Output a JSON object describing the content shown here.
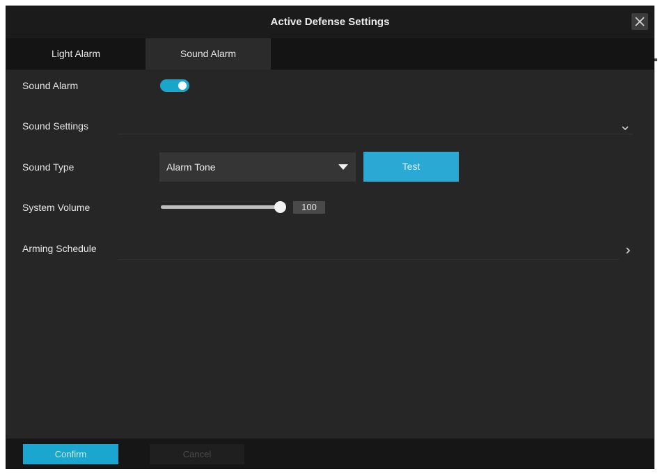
{
  "dialog": {
    "title": "Active Defense Settings"
  },
  "tabs": [
    {
      "label": "Light Alarm",
      "active": false
    },
    {
      "label": "Sound Alarm",
      "active": true
    }
  ],
  "sound_alarm": {
    "label": "Sound Alarm",
    "enabled": true
  },
  "sound_settings": {
    "label": "Sound Settings",
    "expanded": true
  },
  "sound_type": {
    "label": "Sound Type",
    "selected": "Alarm Tone",
    "test_label": "Test"
  },
  "system_volume": {
    "label": "System Volume",
    "value": "100",
    "level_percent": 100
  },
  "arming_schedule": {
    "label": "Arming Schedule"
  },
  "footer": {
    "confirm_label": "Confirm",
    "cancel_label": "Cancel"
  },
  "icons": {
    "close": "close-icon",
    "expand": "chevron-down-icon",
    "navigate": "chevron-right-icon",
    "dropdown": "caret-down-icon"
  },
  "colors": {
    "accent": "#1aa6c9",
    "background": "#262626",
    "titlebar": "#1b1b1b",
    "tab_bar": "#141414",
    "footer": "#161616"
  }
}
